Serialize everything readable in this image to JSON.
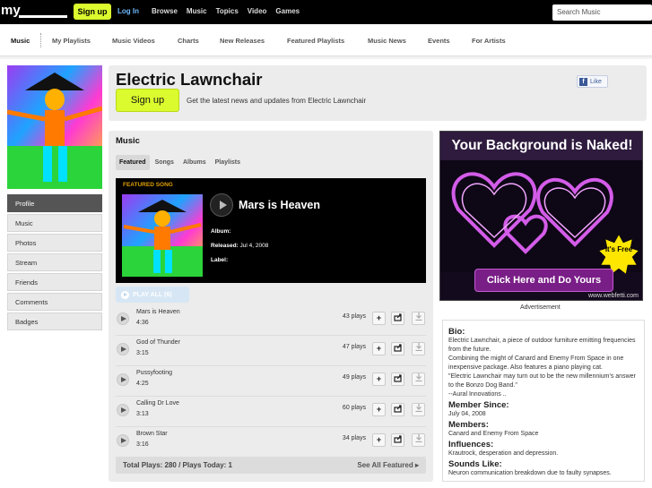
{
  "topbar": {
    "logo_text": "my",
    "signup_label": "Sign up",
    "login_label": "Log In",
    "nav": [
      "Browse",
      "Music",
      "Topics",
      "Video",
      "Games"
    ],
    "search_placeholder": "Search Music"
  },
  "subnav": {
    "items": [
      "Music",
      "My Playlists",
      "Music Videos",
      "Charts",
      "New Releases",
      "Featured Playlists",
      "Music News",
      "Events",
      "For Artists"
    ]
  },
  "profile": {
    "artist_name": "Electric Lawnchair",
    "signup_label": "Sign up",
    "tagline": "Get the latest news and updates from Electric Lawnchair",
    "like_label": "Like",
    "like_icon": "facebook-icon"
  },
  "sidemenu": {
    "items": [
      "Profile",
      "Music",
      "Photos",
      "Stream",
      "Friends",
      "Comments",
      "Badges"
    ],
    "active": "Profile"
  },
  "music": {
    "title": "Music",
    "tabs": [
      "Featured",
      "Songs",
      "Albums",
      "Playlists"
    ],
    "featured_label": "FEATURED SONG",
    "featured_title": "Mars is Heaven",
    "album_label": "Album:",
    "released_label": "Released:",
    "released_value": "Jul 4, 2008",
    "label_label": "Label:",
    "play_all": "PLAY ALL (6)",
    "tracks": [
      {
        "name": "Mars is Heaven",
        "duration": "4:36",
        "plays": "43 plays"
      },
      {
        "name": "God of Thunder",
        "duration": "3:15",
        "plays": "47 plays"
      },
      {
        "name": "Pussyfooting",
        "duration": "4:25",
        "plays": "49 plays"
      },
      {
        "name": "Calling Dr Love",
        "duration": "3:13",
        "plays": "60 plays"
      },
      {
        "name": "Brown Star",
        "duration": "3:16",
        "plays": "34 plays"
      }
    ],
    "add_symbol": "+",
    "footer_stats": "Total Plays: 280 / Plays Today: 1",
    "see_all": "See All Featured ▸"
  },
  "ad": {
    "headline": "Your Background is Naked!",
    "badge": "It's Free",
    "cta": "Click Here and Do Yours",
    "url": "www.webfetti.com",
    "label": "Advertisement"
  },
  "bio": {
    "bio_heading": "Bio:",
    "bio_lines": [
      "Electric Lawnchair, a piece of outdoor furniture emitting frequencies from the future.",
      "Combining the might of Canard and Enemy From Space in one inexpensive package. Also features a piano playing cat.",
      "\"Electric Lawnchair may turn out to be the new millennium's answer to the Bonzo Dog Band.\"",
      "--Aural Innovations .."
    ],
    "member_since_heading": "Member Since:",
    "member_since": "July 04, 2008",
    "members_heading": "Members:",
    "members": "Canard and Enemy From Space",
    "influences_heading": "Influences:",
    "influences": "Krautrock, desperation and depression.",
    "sounds_like_heading": "Sounds Like:",
    "sounds_like": "Neuron communication breakdown due to faulty synapses."
  },
  "colors": {
    "accent": "#dcfb2e",
    "topbar_bg": "#000000",
    "featured_bg": "#000000",
    "featured_label": "#e0a000"
  }
}
